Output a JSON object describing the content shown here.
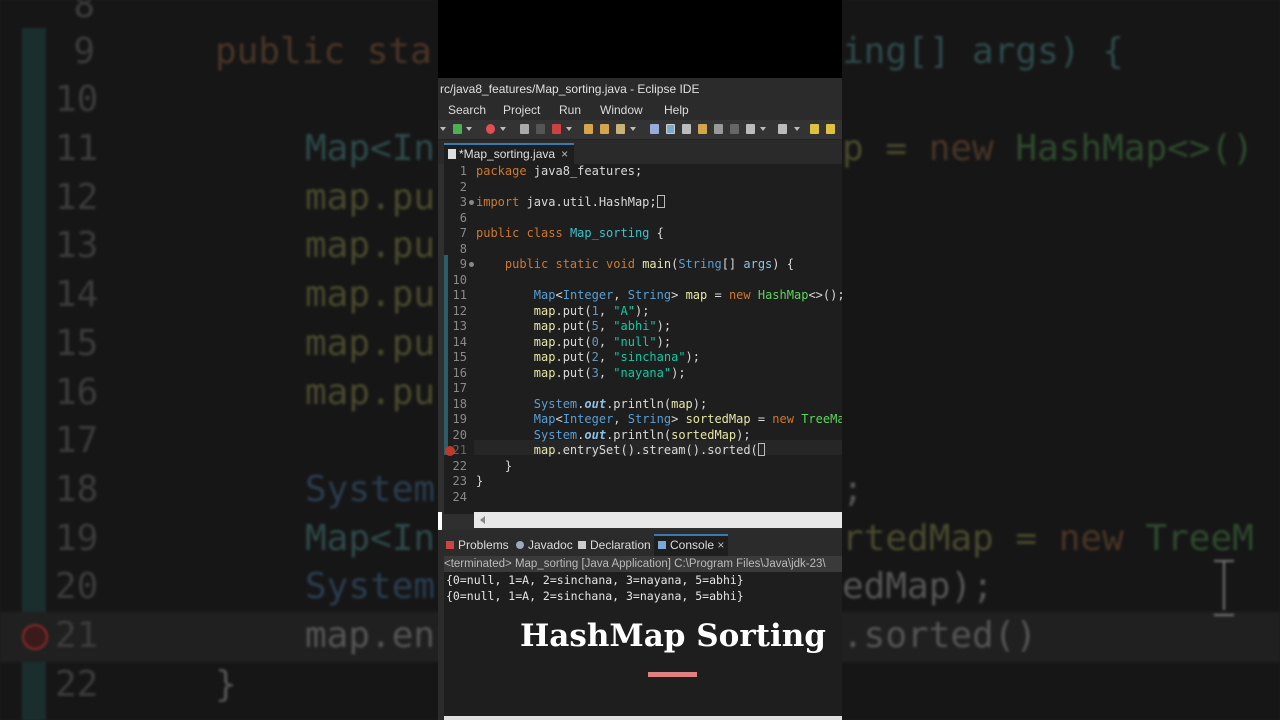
{
  "background": {
    "lines": [
      {
        "num": "8",
        "code": ""
      },
      {
        "num": "9",
        "code": "public sta"
      },
      {
        "num": "10",
        "code": ""
      },
      {
        "num": "11",
        "code": "Map<In"
      },
      {
        "num": "12",
        "code": "map.pu"
      },
      {
        "num": "13",
        "code": "map.pu"
      },
      {
        "num": "14",
        "code": "map.pu"
      },
      {
        "num": "15",
        "code": "map.pu"
      },
      {
        "num": "16",
        "code": "map.pu"
      },
      {
        "num": "17",
        "code": ""
      },
      {
        "num": "18",
        "code": "System"
      },
      {
        "num": "19",
        "code": "Map<In"
      },
      {
        "num": "20",
        "code": "System"
      },
      {
        "num": "21",
        "code": "map.en"
      },
      {
        "num": "22",
        "code": "}"
      }
    ],
    "right_fragments": {
      "line9": "ing[] args) {",
      "line11a": "p = ",
      "line11b": "new",
      "line11c": " HashMap<>()",
      "line18": ";",
      "line19a": "rtedMap = ",
      "line19b": "new",
      "line19c": " TreeM",
      "line20": "edMap);",
      "line21": ".sorted()"
    }
  },
  "window": {
    "title": "rc/java8_features/Map_sorting.java - Eclipse IDE",
    "menu": [
      "Search",
      "Project",
      "Run",
      "Window",
      "Help"
    ],
    "editor_tab": {
      "label": "*Map_sorting.java",
      "close": "×"
    }
  },
  "code": {
    "l1": {
      "n": "1"
    },
    "l2": {
      "n": "2"
    },
    "l3": {
      "n": "3"
    },
    "l6": {
      "n": "6"
    },
    "l7": {
      "n": "7"
    },
    "l8": {
      "n": "8"
    },
    "l9": {
      "n": "9"
    },
    "l10": {
      "n": "10"
    },
    "l11": {
      "n": "11"
    },
    "l12": {
      "n": "12"
    },
    "l13": {
      "n": "13"
    },
    "l14": {
      "n": "14"
    },
    "l15": {
      "n": "15"
    },
    "l16": {
      "n": "16"
    },
    "l17": {
      "n": "17"
    },
    "l18": {
      "n": "18"
    },
    "l19": {
      "n": "19"
    },
    "l20": {
      "n": "20"
    },
    "l21": {
      "n": "21"
    },
    "l22": {
      "n": "22"
    },
    "l23": {
      "n": "23"
    },
    "l24": {
      "n": "24"
    }
  },
  "panel": {
    "tabs": {
      "problems": "Problems",
      "javadoc": "Javadoc",
      "declaration": "Declaration",
      "console": "Console",
      "close": "×"
    },
    "terminated": "<terminated> Map_sorting [Java Application] C:\\Program Files\\Java\\jdk-23\\",
    "output": [
      "{0=null, 1=A, 2=sinchana, 3=nayana, 5=abhi}",
      "{0=null, 1=A, 2=sinchana, 3=nayana, 5=abhi}"
    ]
  },
  "overlay": {
    "title": "HashMap Sorting"
  },
  "colors": {
    "accent_bar": "#e08080",
    "keyword": "#cc7832",
    "type": "#5a9fd4",
    "string": "#17c6a3"
  }
}
